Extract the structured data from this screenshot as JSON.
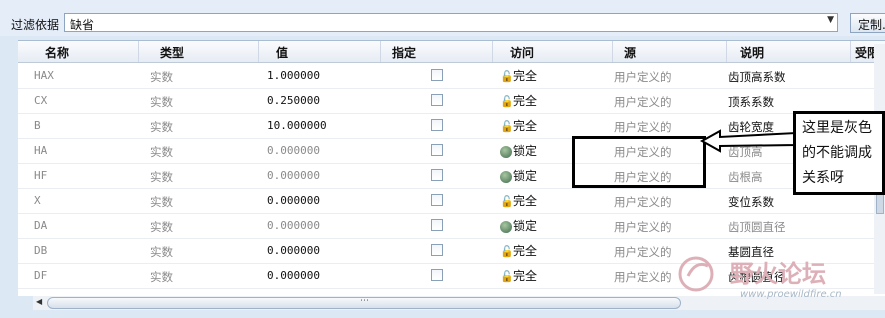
{
  "filter": {
    "label": "过滤依据",
    "value": "缺省",
    "custom_button": "定制..."
  },
  "columns": [
    "名称",
    "类型",
    "值",
    "指定",
    "访问",
    "源",
    "说明",
    "受限"
  ],
  "rows": [
    {
      "name": "HAX",
      "type": "实数",
      "value": "1.000000",
      "access": "完全",
      "source": "用户定义的",
      "desc": "齿顶高系数",
      "gray": false
    },
    {
      "name": "CX",
      "type": "实数",
      "value": "0.250000",
      "access": "完全",
      "source": "用户定义的",
      "desc": "顶系系数",
      "gray": false
    },
    {
      "name": "B",
      "type": "实数",
      "value": "10.000000",
      "access": "完全",
      "source": "用户定义的",
      "desc": "齿轮宽度",
      "gray": false
    },
    {
      "name": "HA",
      "type": "实数",
      "value": "0.000000",
      "access": "锁定",
      "source": "用户定义的",
      "desc": "齿顶高",
      "gray": true
    },
    {
      "name": "HF",
      "type": "实数",
      "value": "0.000000",
      "access": "锁定",
      "source": "用户定义的",
      "desc": "齿根高",
      "gray": true
    },
    {
      "name": "X",
      "type": "实数",
      "value": "0.000000",
      "access": "完全",
      "source": "用户定义的",
      "desc": "变位系数",
      "gray": false
    },
    {
      "name": "DA",
      "type": "实数",
      "value": "0.000000",
      "access": "锁定",
      "source": "用户定义的",
      "desc": "齿顶圆直径",
      "gray": true
    },
    {
      "name": "DB",
      "type": "实数",
      "value": "0.000000",
      "access": "完全",
      "source": "用户定义的",
      "desc": "基圆直径",
      "gray": false
    },
    {
      "name": "DF",
      "type": "实数",
      "value": "0.000000",
      "access": "完全",
      "source": "用户定义的",
      "desc": "齿根圆直径",
      "gray": false
    }
  ],
  "annotation": {
    "text": "这里是灰色的不能调成关系呀"
  },
  "watermark": {
    "text": "野火论坛",
    "url": "www.proewildfire.cn"
  },
  "colors": {
    "locked_text": "#8a8a8a",
    "header_bg": "#e6ecf4",
    "window_bg": "#dde8f5"
  }
}
